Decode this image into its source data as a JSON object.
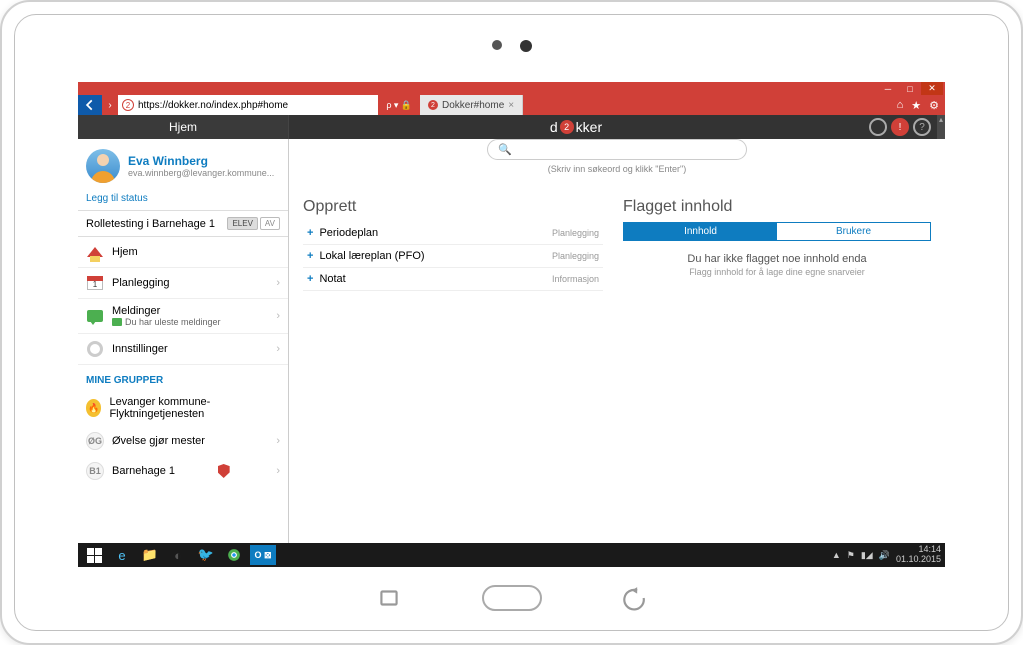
{
  "browser": {
    "url": "https://dokker.no/index.php#home",
    "search_indicator": "🔒",
    "tab_title": "Dokker#home",
    "search_sep": "ρ ▾"
  },
  "app": {
    "hjem_header": "Hjem",
    "brand_left": "d",
    "brand_num": "2",
    "brand_right": "kker",
    "notif": "!",
    "help": "?"
  },
  "profile": {
    "name": "Eva Winnberg",
    "email": "eva.winnberg@levanger.kommune...",
    "add_status": "Legg til status"
  },
  "role": {
    "label": "Rolletesting i Barnehage 1",
    "pill1": "ELEV",
    "pill2": "AV"
  },
  "nav": {
    "home": "Hjem",
    "planning": "Planlegging",
    "messages": "Meldinger",
    "messages_sub": "Du har uleste meldinger",
    "settings": "Innstillinger"
  },
  "groups": {
    "header": "MINE GRUPPER",
    "g1_badge": "",
    "g1": "Levanger kommune- Flyktningetjenesten",
    "g2_badge": "ØG",
    "g2": "Øvelse gjør mester",
    "g3_badge": "B1",
    "g3": "Barnehage 1"
  },
  "search": {
    "placeholder": "",
    "hint": "(Skriv inn søkeord og klikk \"Enter\")"
  },
  "create": {
    "title": "Opprett",
    "items": [
      {
        "label": "Periodeplan",
        "tag": "Planlegging"
      },
      {
        "label": "Lokal læreplan (PFO)",
        "tag": "Planlegging"
      },
      {
        "label": "Notat",
        "tag": "Informasjon"
      }
    ]
  },
  "flagged": {
    "title": "Flagget innhold",
    "tab1": "Innhold",
    "tab2": "Brukere",
    "empty": "Du har ikke flagget noe innhold enda",
    "empty_sub": "Flagg innhold for å lage dine egne snarveier"
  },
  "taskbar": {
    "time": "14:14",
    "date": "01.10.2015"
  }
}
